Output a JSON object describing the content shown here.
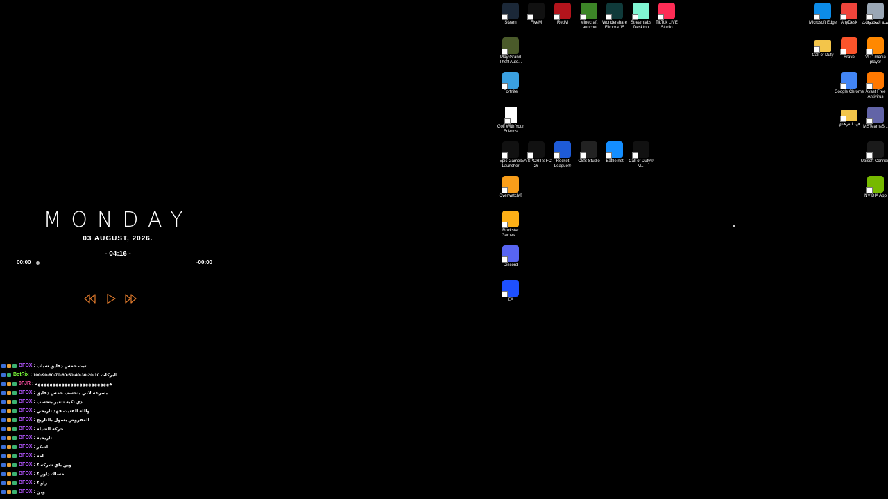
{
  "desktop": {
    "icons_col1_top": [
      {
        "label": "Steam",
        "icon": "steam-icon",
        "color": "#1b2838"
      },
      {
        "label": "FiveM",
        "icon": "fivem-icon",
        "color": "#111111"
      },
      {
        "label": "RedM",
        "icon": "redm-icon",
        "color": "#b3141c"
      },
      {
        "label": "Minecraft Launcher",
        "icon": "minecraft-icon",
        "color": "#3c8527"
      },
      {
        "label": "Wondershare Filmora 15",
        "icon": "filmora-icon",
        "color": "#0f3a3a"
      },
      {
        "label": "Streamlabs Desktop",
        "icon": "streamlabs-icon",
        "color": "#80f5d2"
      },
      {
        "label": "TikTok LIVE Studio",
        "icon": "tiktok-icon",
        "color": "#fe2c55"
      }
    ],
    "icons_col1": [
      {
        "label": "Play Grand Theft Auto...",
        "icon": "gta-icon",
        "color": "#4a5a2a"
      },
      {
        "label": "Fortnite",
        "icon": "fortnite-icon",
        "color": "#3aa0e0"
      },
      {
        "label": "Golf With Your Friends",
        "icon": "file-icon",
        "color": "#ffffff"
      }
    ],
    "icons_row_mid": [
      {
        "label": "Epic Games Launcher",
        "icon": "epic-icon",
        "color": "#111111"
      },
      {
        "label": "EA SPORTS FC 26",
        "icon": "eafc-icon",
        "color": "#111111"
      },
      {
        "label": "Rocket League®",
        "icon": "rocket-league-icon",
        "color": "#1e5bd8"
      },
      {
        "label": "OBS Studio",
        "icon": "obs-icon",
        "color": "#222222"
      },
      {
        "label": "Battle.net",
        "icon": "battlenet-icon",
        "color": "#148eff"
      },
      {
        "label": "Call of Duty® M...",
        "icon": "mw3-icon",
        "color": "#111111"
      }
    ],
    "icons_col1_lower": [
      {
        "label": "Overwatch®",
        "icon": "overwatch-icon",
        "color": "#f99e1a"
      },
      {
        "label": "Rockstar Games ...",
        "icon": "rockstar-icon",
        "color": "#fcaf17"
      },
      {
        "label": "Discord",
        "icon": "discord-icon",
        "color": "#5865f2"
      },
      {
        "label": "EA",
        "icon": "ea-icon",
        "color": "#1e50ff"
      }
    ],
    "icons_right": [
      {
        "label": "Microsoft Edge",
        "icon": "edge-icon",
        "color": "#0c8ce9"
      },
      {
        "label": "AnyDesk",
        "icon": "anydesk-icon",
        "color": "#ef443b"
      },
      {
        "label": "سلة المحذوفات",
        "icon": "recycle-bin-icon",
        "color": "#9aa7b5"
      },
      {
        "label": "Call of Duty",
        "icon": "folder-icon",
        "color": "#f3c54a"
      },
      {
        "label": "Brave",
        "icon": "brave-icon",
        "color": "#fb542b"
      },
      {
        "label": "VLC media player",
        "icon": "vlc-icon",
        "color": "#ff8800"
      },
      {
        "label": "Google Chrome",
        "icon": "chrome-icon",
        "color": "#4285f4"
      },
      {
        "label": "Avast Free Antivirus",
        "icon": "avast-icon",
        "color": "#ff7800"
      },
      {
        "label": "فهد القرهدي",
        "icon": "folder-icon",
        "color": "#f3c54a"
      },
      {
        "label": "MSTeamsS...",
        "icon": "teams-icon",
        "color": "#6264a7"
      },
      {
        "label": "Ubisoft Connect",
        "icon": "ubisoft-icon",
        "color": "#1a1a1a"
      },
      {
        "label": "NVIDIA App",
        "icon": "nvidia-icon",
        "color": "#76b900"
      }
    ]
  },
  "clock": {
    "weekday": "MONDAY",
    "date": "03 AUGUST, 2026.",
    "time": "- 04:16 -"
  },
  "player": {
    "elapsed": "00:00",
    "remaining": "-00:00",
    "progress": 0,
    "accent": "#e07a2c",
    "controls": [
      "rewind-icon",
      "play-icon",
      "fast-forward-icon"
    ]
  },
  "chat": {
    "colors": {
      "BFOX": "#b455ff",
      "BotRix": "#7cff3a",
      "0FJR": "#ff4fa3"
    },
    "messages": [
      {
        "user": "BFOX",
        "text": "ثبت خمس دقايق شباب"
      },
      {
        "user": "BotRix",
        "text": "البركات 10-20-30-40-50-60-70-80-90-100"
      },
      {
        "user": "0FJR",
        "text": "هههههههههههههههههههههههههه"
      },
      {
        "user": "BFOX",
        "text": "بسرعه لاني بتحسب خمس دقايق"
      },
      {
        "user": "BFOX",
        "text": "دي ثكيه تتغير بتحسب"
      },
      {
        "user": "BFOX",
        "text": "والله الفئيت فهد تاريخي"
      },
      {
        "user": "BFOX",
        "text": "المفروض بسول بالتاريخ"
      },
      {
        "user": "BFOX",
        "text": "حركه الشيله"
      },
      {
        "user": "BFOX",
        "text": "تاريخيه"
      },
      {
        "user": "BFOX",
        "text": "اشكر"
      },
      {
        "user": "BFOX",
        "text": "امه"
      },
      {
        "user": "BFOX",
        "text": "وين باي شركه ؟"
      },
      {
        "user": "BFOX",
        "text": "مساك داور ؟"
      },
      {
        "user": "BFOX",
        "text": "راو ؟"
      },
      {
        "user": "BFOX",
        "text": "وين"
      }
    ]
  }
}
